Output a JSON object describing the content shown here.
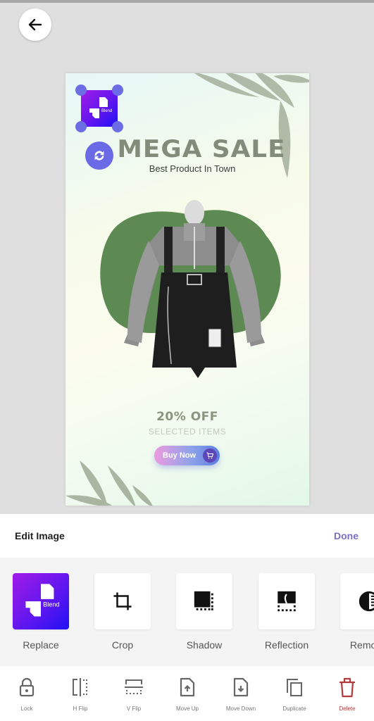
{
  "header": {
    "back_icon": "arrow-left-icon"
  },
  "poster": {
    "headline": "MEGA SALE",
    "subheadline": "Best Product In Town",
    "offer": "20% OFF",
    "offer_sub": "SELECTED ITEMS",
    "cta_label": "Buy Now",
    "cta_icon": "cart-icon",
    "logo_text": "Blend"
  },
  "panel": {
    "title": "Edit Image",
    "done_label": "Done",
    "tools": [
      {
        "label": "Replace",
        "icon": "blend-logo-icon"
      },
      {
        "label": "Crop",
        "icon": "crop-icon"
      },
      {
        "label": "Shadow",
        "icon": "shadow-icon"
      },
      {
        "label": "Reflection",
        "icon": "reflection-icon"
      },
      {
        "label": "Remove",
        "icon": "remove-bg-icon"
      }
    ]
  },
  "bottom_bar": [
    {
      "label": "Lock",
      "icon": "lock-icon"
    },
    {
      "label": "H Flip",
      "icon": "h-flip-icon"
    },
    {
      "label": "V Flip",
      "icon": "v-flip-icon"
    },
    {
      "label": "Move Up",
      "icon": "move-up-icon"
    },
    {
      "label": "Move Down",
      "icon": "move-down-icon"
    },
    {
      "label": "Duplicate",
      "icon": "duplicate-icon"
    },
    {
      "label": "Delete",
      "icon": "delete-icon"
    }
  ],
  "colors": {
    "accent": "#7a6fc4",
    "delete": "#b23a3a",
    "handle": "#6c6ce5",
    "blob": "#5c8a52"
  }
}
